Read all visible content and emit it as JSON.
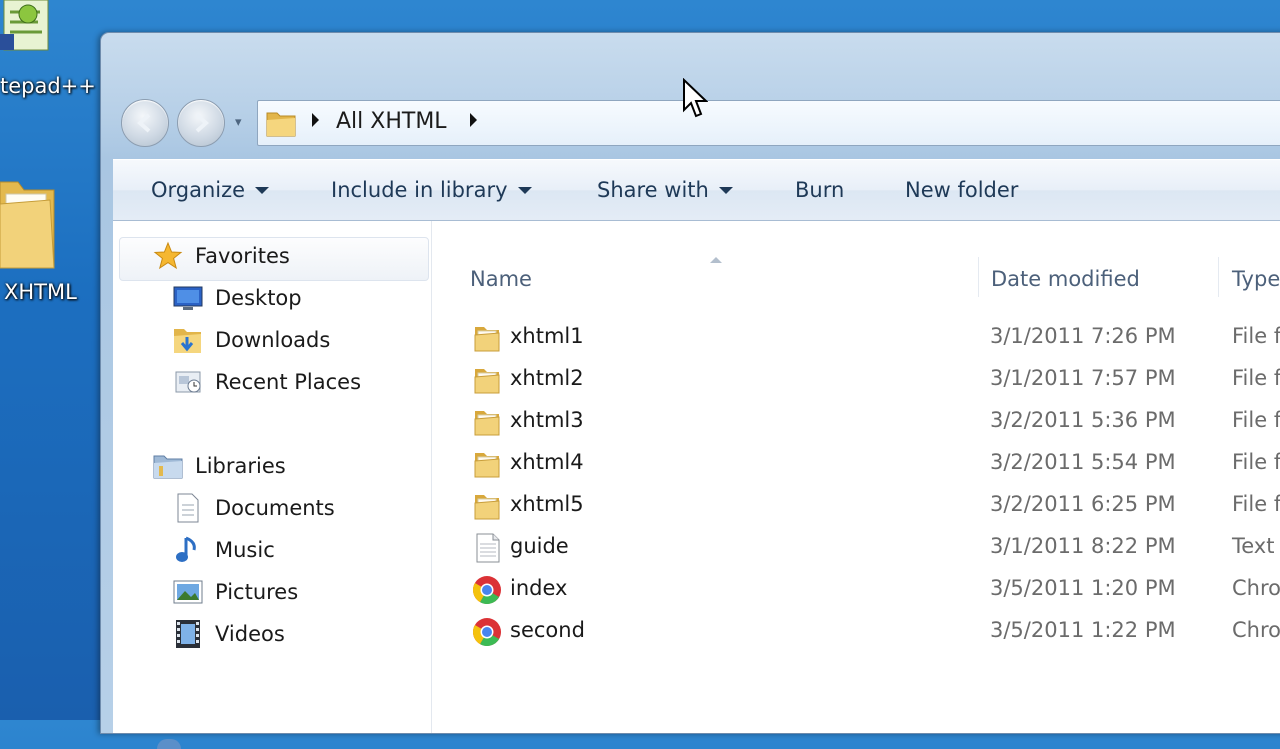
{
  "desktop": {
    "icons": [
      {
        "label": "tepad++",
        "icon": "notepad-plus-plus-icon"
      },
      {
        "label": "XHTML",
        "icon": "folder-icon"
      }
    ]
  },
  "address_bar": {
    "location": "All XHTML",
    "back_icon": "back-arrow-icon",
    "forward_icon": "forward-arrow-icon"
  },
  "toolbar": {
    "organize": "Organize",
    "include_in_library": "Include in library",
    "share_with": "Share with",
    "burn": "Burn",
    "new_folder": "New folder"
  },
  "navigation": {
    "favorites": {
      "label": "Favorites",
      "items": [
        {
          "label": "Desktop",
          "icon": "desktop-icon"
        },
        {
          "label": "Downloads",
          "icon": "downloads-icon"
        },
        {
          "label": "Recent Places",
          "icon": "recent-places-icon"
        }
      ]
    },
    "libraries": {
      "label": "Libraries",
      "items": [
        {
          "label": "Documents",
          "icon": "documents-icon"
        },
        {
          "label": "Music",
          "icon": "music-icon"
        },
        {
          "label": "Pictures",
          "icon": "pictures-icon"
        },
        {
          "label": "Videos",
          "icon": "videos-icon"
        }
      ]
    }
  },
  "file_list": {
    "columns": {
      "name": "Name",
      "date_modified": "Date modified",
      "type": "Type"
    },
    "rows": [
      {
        "name": "xhtml1",
        "date": "3/1/2011 7:26 PM",
        "type": "File f",
        "icon": "folder-icon"
      },
      {
        "name": "xhtml2",
        "date": "3/1/2011 7:57 PM",
        "type": "File f",
        "icon": "folder-icon"
      },
      {
        "name": "xhtml3",
        "date": "3/2/2011 5:36 PM",
        "type": "File f",
        "icon": "folder-icon"
      },
      {
        "name": "xhtml4",
        "date": "3/2/2011 5:54 PM",
        "type": "File f",
        "icon": "folder-icon"
      },
      {
        "name": "xhtml5",
        "date": "3/2/2011 6:25 PM",
        "type": "File f",
        "icon": "folder-icon"
      },
      {
        "name": "guide",
        "date": "3/1/2011 8:22 PM",
        "type": "Text",
        "icon": "text-document-icon"
      },
      {
        "name": "index",
        "date": "3/5/2011 1:20 PM",
        "type": "Chro",
        "icon": "chrome-html-icon"
      },
      {
        "name": "second",
        "date": "3/5/2011 1:22 PM",
        "type": "Chro",
        "icon": "chrome-html-icon"
      }
    ]
  },
  "colors": {
    "desktop_blue": "#1c6fc0",
    "command_text": "#1e3957",
    "header_text": "#4c607a",
    "folder_yellow": "#f2d27a"
  }
}
